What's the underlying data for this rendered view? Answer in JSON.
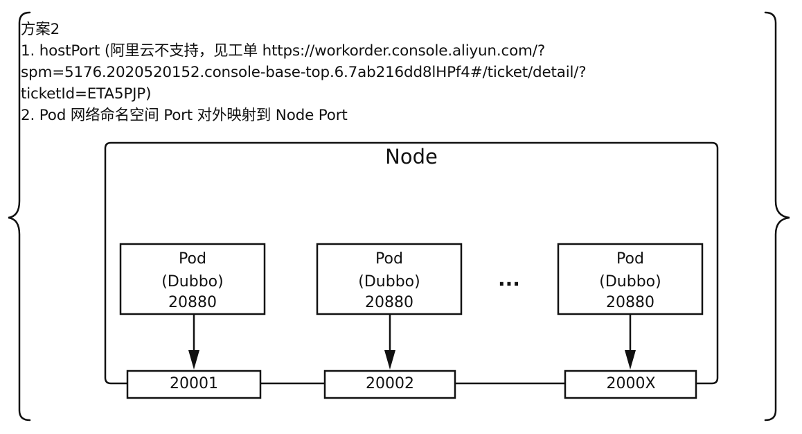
{
  "header": {
    "lines": [
      "方案2",
      "1. hostPort (阿里云不支持，见工单 https://workorder.console.aliyun.com/?",
      "spm=5176.2020520152.console-base-top.6.7ab216dd8lHPf4#/ticket/detail/?",
      "ticketId=ETA5PJP)",
      "2. Pod 网络命名空间 Port 对外映射到 Node Port"
    ]
  },
  "diagram": {
    "node_label": "Node",
    "ellipsis": "...",
    "pods": [
      {
        "line1": "Pod",
        "line2": "(Dubbo)",
        "line3": "20880"
      },
      {
        "line1": "Pod",
        "line2": "(Dubbo)",
        "line3": "20880"
      },
      {
        "line1": "Pod",
        "line2": "(Dubbo)",
        "line3": "20880"
      }
    ],
    "ports": [
      "20001",
      "20002",
      "2000X"
    ]
  },
  "colors": {
    "stroke": "#111111",
    "background": "#ffffff"
  }
}
